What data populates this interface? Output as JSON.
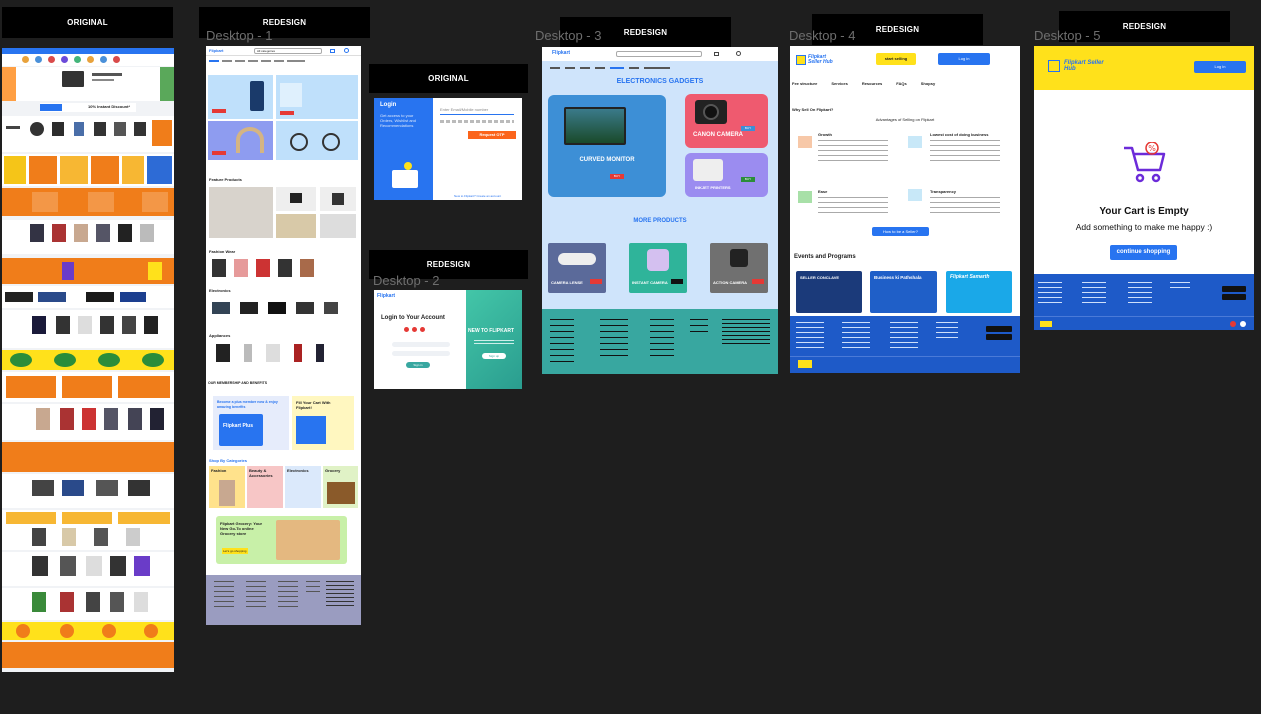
{
  "tags": {
    "original_1": "ORIGINAL",
    "redesign_1": "REDESIGN",
    "original_2": "ORIGINAL",
    "redesign_2": "REDESIGN",
    "redesign_3": "REDESIGN",
    "redesign_4": "REDESIGN",
    "redesign_5": "REDESIGN"
  },
  "frames": {
    "desktop1": "Desktop - 1",
    "desktop2": "Desktop - 2",
    "desktop3": "Desktop - 3",
    "desktop4": "Desktop - 4",
    "desktop5": "Desktop - 5"
  },
  "original_home": {
    "banner": "10% Instant Discount*"
  },
  "desktop1": {
    "logo": "Flipkart",
    "search_placeholder": "All categories",
    "feature_products": "Feature Products",
    "fashion_wear": "Fashion Wear",
    "electronics": "Electronics",
    "appliances": "Appliances",
    "membership": "OUR MEMBERSHIP AND BENEFITS",
    "plus_title": "Become a plus member now & enjoy amazing benefits",
    "plus_badge": "Flipkart Plus",
    "fill_cart": "Fill Your Cart With Flipkart!",
    "shop_by_categories": "Shop By Categories",
    "cat_fashion": "Fashion",
    "cat_beauty": "Beauty & Accessories",
    "cat_electronics": "Electronics",
    "cat_grocery": "Grocery",
    "grocery_title": "Flipkart Grocery: Your New Go-To online Grocery store",
    "grocery_btn": "Let's go shopping"
  },
  "login_original": {
    "title": "Login",
    "subtitle": "Get access to your Orders, Wishlist and Recommendations",
    "input_placeholder": "Enter Email/Mobile number",
    "button": "Request OTP",
    "footer": "New to Flipkart? Create an account"
  },
  "desktop2": {
    "logo": "Flipkart",
    "title": "Login to Your Account",
    "new_to": "NEW TO FLIPKART",
    "button": "Sign in",
    "signup": "Sign up"
  },
  "desktop3": {
    "logo": "Flipkart",
    "heading": "ELECTRONICS GADGETS",
    "curved_monitor": "CURVED MONITOR",
    "canon_camera": "CANON CAMERA",
    "inkjet_printers": "INKJET PRINTERS",
    "more_products": "MORE PRODUCTS",
    "camera_lense": "CAMERA LENSE",
    "instant_camera": "INSTANT CAMERA",
    "action_camera": "ACTION CAMERA",
    "buy": "BUY"
  },
  "desktop4": {
    "brand": "Flipkart Seller Hub",
    "start_selling": "start selling",
    "login": "Log in",
    "nav": [
      "Fee structure",
      "Services",
      "Resources",
      "FAQs",
      "Shopsy"
    ],
    "why": "Why Sell On Flipkart?",
    "advantages": "Advantages of Selling on Flipkart",
    "growth": "Growth",
    "lowest_cost": "Lowest cost of doing business",
    "ease": "Ease",
    "transparency": "Transparency",
    "how_to": "How to be a Seller?",
    "events": "Events and Programs",
    "event1": "SELLER CONCLAVE",
    "event2": "Business ki Pathshala",
    "event3": "Flipkart Samarth"
  },
  "desktop5": {
    "brand": "Flipkart Seller Hub",
    "login": "Log in",
    "empty_title": "Your Cart is Empty",
    "empty_sub": "Add something to make me happy :)",
    "button": "continue shopping"
  },
  "colors": {
    "canvas": "#1e1e1e",
    "flipkart_blue": "#2874f0",
    "flipkart_yellow": "#ffe11b",
    "orange": "#f07d1a",
    "desktop3_bg": "#cfe4fb",
    "teal": "#38a7a0"
  }
}
